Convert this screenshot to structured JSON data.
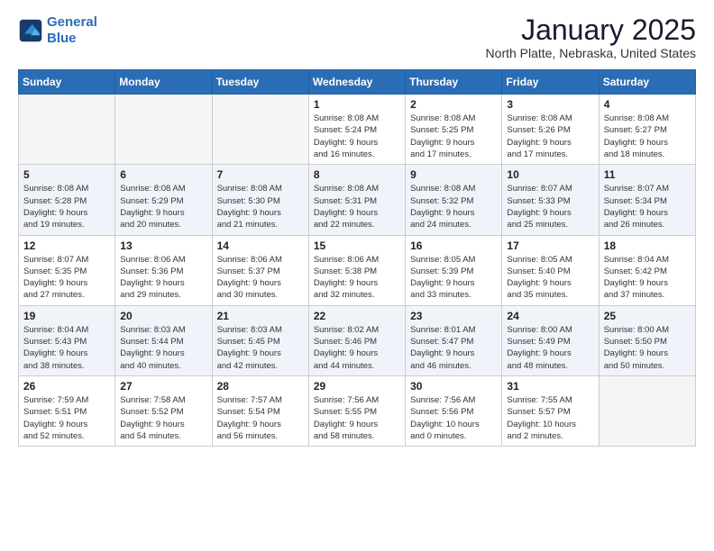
{
  "header": {
    "logo_line1": "General",
    "logo_line2": "Blue",
    "title": "January 2025",
    "location": "North Platte, Nebraska, United States"
  },
  "weekdays": [
    "Sunday",
    "Monday",
    "Tuesday",
    "Wednesday",
    "Thursday",
    "Friday",
    "Saturday"
  ],
  "weeks": [
    [
      {
        "day": "",
        "info": ""
      },
      {
        "day": "",
        "info": ""
      },
      {
        "day": "",
        "info": ""
      },
      {
        "day": "1",
        "info": "Sunrise: 8:08 AM\nSunset: 5:24 PM\nDaylight: 9 hours\nand 16 minutes."
      },
      {
        "day": "2",
        "info": "Sunrise: 8:08 AM\nSunset: 5:25 PM\nDaylight: 9 hours\nand 17 minutes."
      },
      {
        "day": "3",
        "info": "Sunrise: 8:08 AM\nSunset: 5:26 PM\nDaylight: 9 hours\nand 17 minutes."
      },
      {
        "day": "4",
        "info": "Sunrise: 8:08 AM\nSunset: 5:27 PM\nDaylight: 9 hours\nand 18 minutes."
      }
    ],
    [
      {
        "day": "5",
        "info": "Sunrise: 8:08 AM\nSunset: 5:28 PM\nDaylight: 9 hours\nand 19 minutes."
      },
      {
        "day": "6",
        "info": "Sunrise: 8:08 AM\nSunset: 5:29 PM\nDaylight: 9 hours\nand 20 minutes."
      },
      {
        "day": "7",
        "info": "Sunrise: 8:08 AM\nSunset: 5:30 PM\nDaylight: 9 hours\nand 21 minutes."
      },
      {
        "day": "8",
        "info": "Sunrise: 8:08 AM\nSunset: 5:31 PM\nDaylight: 9 hours\nand 22 minutes."
      },
      {
        "day": "9",
        "info": "Sunrise: 8:08 AM\nSunset: 5:32 PM\nDaylight: 9 hours\nand 24 minutes."
      },
      {
        "day": "10",
        "info": "Sunrise: 8:07 AM\nSunset: 5:33 PM\nDaylight: 9 hours\nand 25 minutes."
      },
      {
        "day": "11",
        "info": "Sunrise: 8:07 AM\nSunset: 5:34 PM\nDaylight: 9 hours\nand 26 minutes."
      }
    ],
    [
      {
        "day": "12",
        "info": "Sunrise: 8:07 AM\nSunset: 5:35 PM\nDaylight: 9 hours\nand 27 minutes."
      },
      {
        "day": "13",
        "info": "Sunrise: 8:06 AM\nSunset: 5:36 PM\nDaylight: 9 hours\nand 29 minutes."
      },
      {
        "day": "14",
        "info": "Sunrise: 8:06 AM\nSunset: 5:37 PM\nDaylight: 9 hours\nand 30 minutes."
      },
      {
        "day": "15",
        "info": "Sunrise: 8:06 AM\nSunset: 5:38 PM\nDaylight: 9 hours\nand 32 minutes."
      },
      {
        "day": "16",
        "info": "Sunrise: 8:05 AM\nSunset: 5:39 PM\nDaylight: 9 hours\nand 33 minutes."
      },
      {
        "day": "17",
        "info": "Sunrise: 8:05 AM\nSunset: 5:40 PM\nDaylight: 9 hours\nand 35 minutes."
      },
      {
        "day": "18",
        "info": "Sunrise: 8:04 AM\nSunset: 5:42 PM\nDaylight: 9 hours\nand 37 minutes."
      }
    ],
    [
      {
        "day": "19",
        "info": "Sunrise: 8:04 AM\nSunset: 5:43 PM\nDaylight: 9 hours\nand 38 minutes."
      },
      {
        "day": "20",
        "info": "Sunrise: 8:03 AM\nSunset: 5:44 PM\nDaylight: 9 hours\nand 40 minutes."
      },
      {
        "day": "21",
        "info": "Sunrise: 8:03 AM\nSunset: 5:45 PM\nDaylight: 9 hours\nand 42 minutes."
      },
      {
        "day": "22",
        "info": "Sunrise: 8:02 AM\nSunset: 5:46 PM\nDaylight: 9 hours\nand 44 minutes."
      },
      {
        "day": "23",
        "info": "Sunrise: 8:01 AM\nSunset: 5:47 PM\nDaylight: 9 hours\nand 46 minutes."
      },
      {
        "day": "24",
        "info": "Sunrise: 8:00 AM\nSunset: 5:49 PM\nDaylight: 9 hours\nand 48 minutes."
      },
      {
        "day": "25",
        "info": "Sunrise: 8:00 AM\nSunset: 5:50 PM\nDaylight: 9 hours\nand 50 minutes."
      }
    ],
    [
      {
        "day": "26",
        "info": "Sunrise: 7:59 AM\nSunset: 5:51 PM\nDaylight: 9 hours\nand 52 minutes."
      },
      {
        "day": "27",
        "info": "Sunrise: 7:58 AM\nSunset: 5:52 PM\nDaylight: 9 hours\nand 54 minutes."
      },
      {
        "day": "28",
        "info": "Sunrise: 7:57 AM\nSunset: 5:54 PM\nDaylight: 9 hours\nand 56 minutes."
      },
      {
        "day": "29",
        "info": "Sunrise: 7:56 AM\nSunset: 5:55 PM\nDaylight: 9 hours\nand 58 minutes."
      },
      {
        "day": "30",
        "info": "Sunrise: 7:56 AM\nSunset: 5:56 PM\nDaylight: 10 hours\nand 0 minutes."
      },
      {
        "day": "31",
        "info": "Sunrise: 7:55 AM\nSunset: 5:57 PM\nDaylight: 10 hours\nand 2 minutes."
      },
      {
        "day": "",
        "info": ""
      }
    ]
  ]
}
